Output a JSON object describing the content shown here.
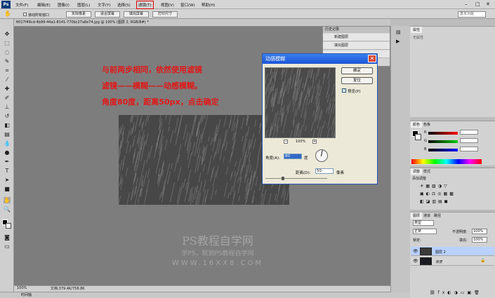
{
  "app": {
    "logo": "Ps"
  },
  "menus": [
    "文件(F)",
    "编辑(E)",
    "图像(I)",
    "图层(L)",
    "文字(Y)",
    "选择(S)",
    "滤镜(T)",
    "视图(V)",
    "窗口(W)",
    "帮助(H)"
  ],
  "options": {
    "scroll_all": "滚动所有窗口",
    "actual_pixels": "实际像素",
    "fit_screen": "适合屏幕",
    "fill_screen": "填充屏幕",
    "print_size": "打印尺寸",
    "workspace": "基本功能"
  },
  "document": {
    "tab_title": "6017f49cd-4b99-44a1-8141-770bc27a8e74.jpg @ 100% (图层 2, RGB/8#) *",
    "zoom": "100%",
    "doc_size": "文档:379.4K/758.8K"
  },
  "annotation": {
    "line1": "与前两步相同，依然使用滤镜",
    "line2": "滤镜——模糊——动感模糊。",
    "line3": "角度80度，距离50px，点击确定"
  },
  "watermark": {
    "title": "PS教程自学网",
    "subtitle": "学PS，就到PS教程自学网",
    "url": "WWW.16XX8.COM"
  },
  "history": {
    "tab": "历史记录",
    "items": [
      "新建图层",
      "填充图层"
    ]
  },
  "dialog": {
    "title": "动感模糊",
    "ok": "确定",
    "reset": "复位",
    "preview_label": "预览(P)",
    "zoom": "100%",
    "angle_label": "角度(A):",
    "angle_value": "80",
    "angle_unit": "度",
    "distance_label": "距离(D):",
    "distance_value": "50",
    "distance_unit": "像素"
  },
  "panels": {
    "properties": {
      "tab": "属性",
      "note": "无属性"
    },
    "color": {
      "tab_color": "颜色",
      "tab_swatches": "色板",
      "channels": [
        "R",
        "G",
        "B"
      ]
    },
    "adjustments": {
      "tab_adjust": "调整",
      "tab_style": "样式",
      "add": "添加调整"
    },
    "layers": {
      "tabs": [
        "图层",
        "通道",
        "路径"
      ],
      "kind": "类型",
      "blend": "正常",
      "opacity_label": "不透明度:",
      "opacity": "100%",
      "lock_label": "锁定:",
      "fill_label": "填充:",
      "fill": "100%",
      "items": [
        {
          "name": "图层 2",
          "selected": true
        },
        {
          "name": "背景",
          "selected": false
        }
      ]
    }
  },
  "bottom": {
    "tab": "时间轴"
  },
  "colors": {
    "accent_red": "#e21818",
    "title_blue": "#1d55d4"
  }
}
